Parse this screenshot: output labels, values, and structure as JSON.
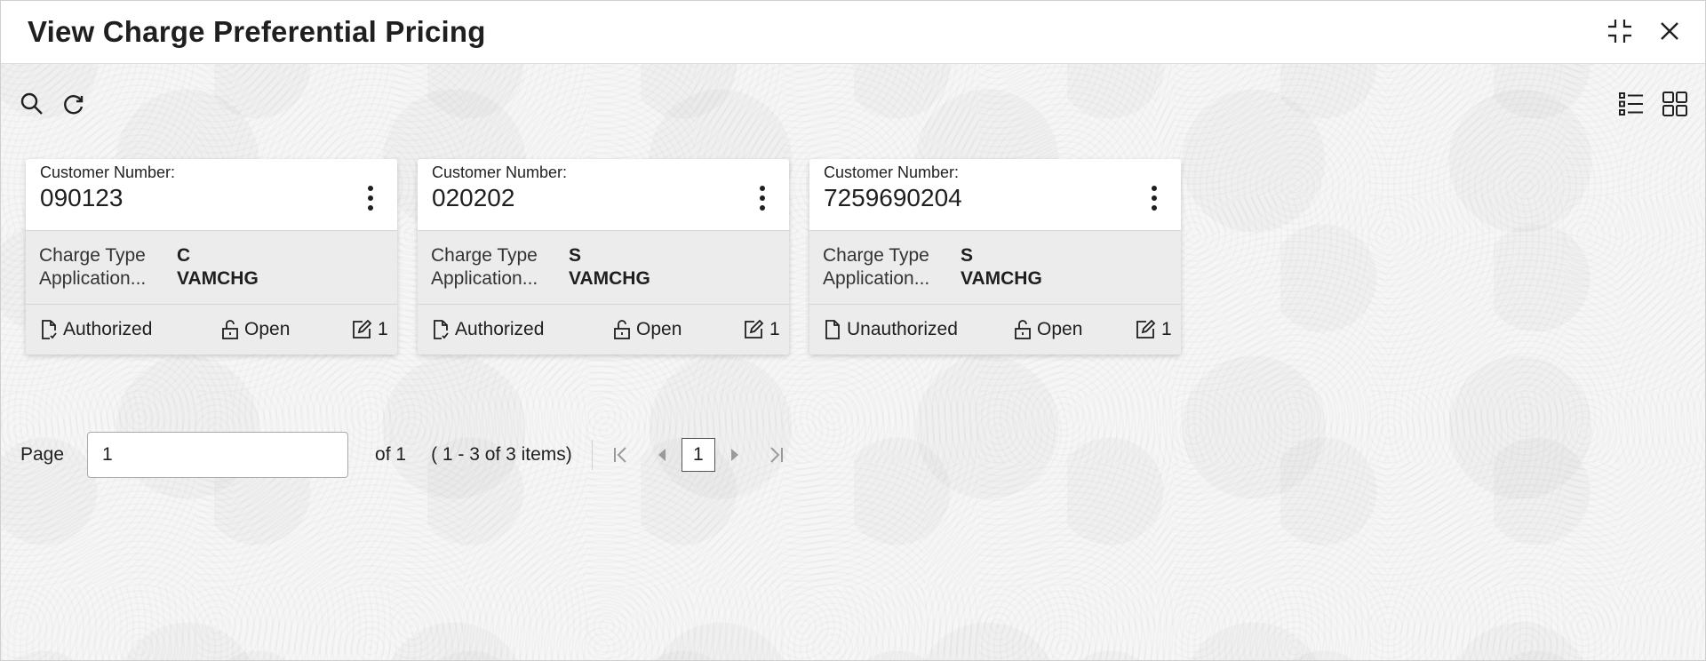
{
  "window": {
    "title": "View Charge Preferential Pricing"
  },
  "cards": [
    {
      "customer_label": "Customer Number:",
      "customer_number": "090123",
      "charge_type_label": "Charge Type",
      "charge_type_value": "C",
      "application_label": "Application...",
      "application_value": "VAMCHG",
      "auth_status": "Authorized",
      "record_status": "Open",
      "mod_count": "1"
    },
    {
      "customer_label": "Customer Number:",
      "customer_number": "020202",
      "charge_type_label": "Charge Type",
      "charge_type_value": "S",
      "application_label": "Application...",
      "application_value": "VAMCHG",
      "auth_status": "Authorized",
      "record_status": "Open",
      "mod_count": "1"
    },
    {
      "customer_label": "Customer Number:",
      "customer_number": "7259690204",
      "charge_type_label": "Charge Type",
      "charge_type_value": "S",
      "application_label": "Application...",
      "application_value": "VAMCHG",
      "auth_status": "Unauthorized",
      "record_status": "Open",
      "mod_count": "1"
    }
  ],
  "pagination": {
    "page_label": "Page",
    "page_value": "1",
    "of_text": "of 1",
    "items_text": "( 1 - 3 of 3 items)",
    "current_page": "1"
  },
  "icons": {
    "minimize": "minimize-icon",
    "close": "close-icon",
    "search": "search-icon",
    "refresh": "refresh-icon",
    "list_view": "list-view-icon",
    "grid_view": "grid-view-icon"
  }
}
